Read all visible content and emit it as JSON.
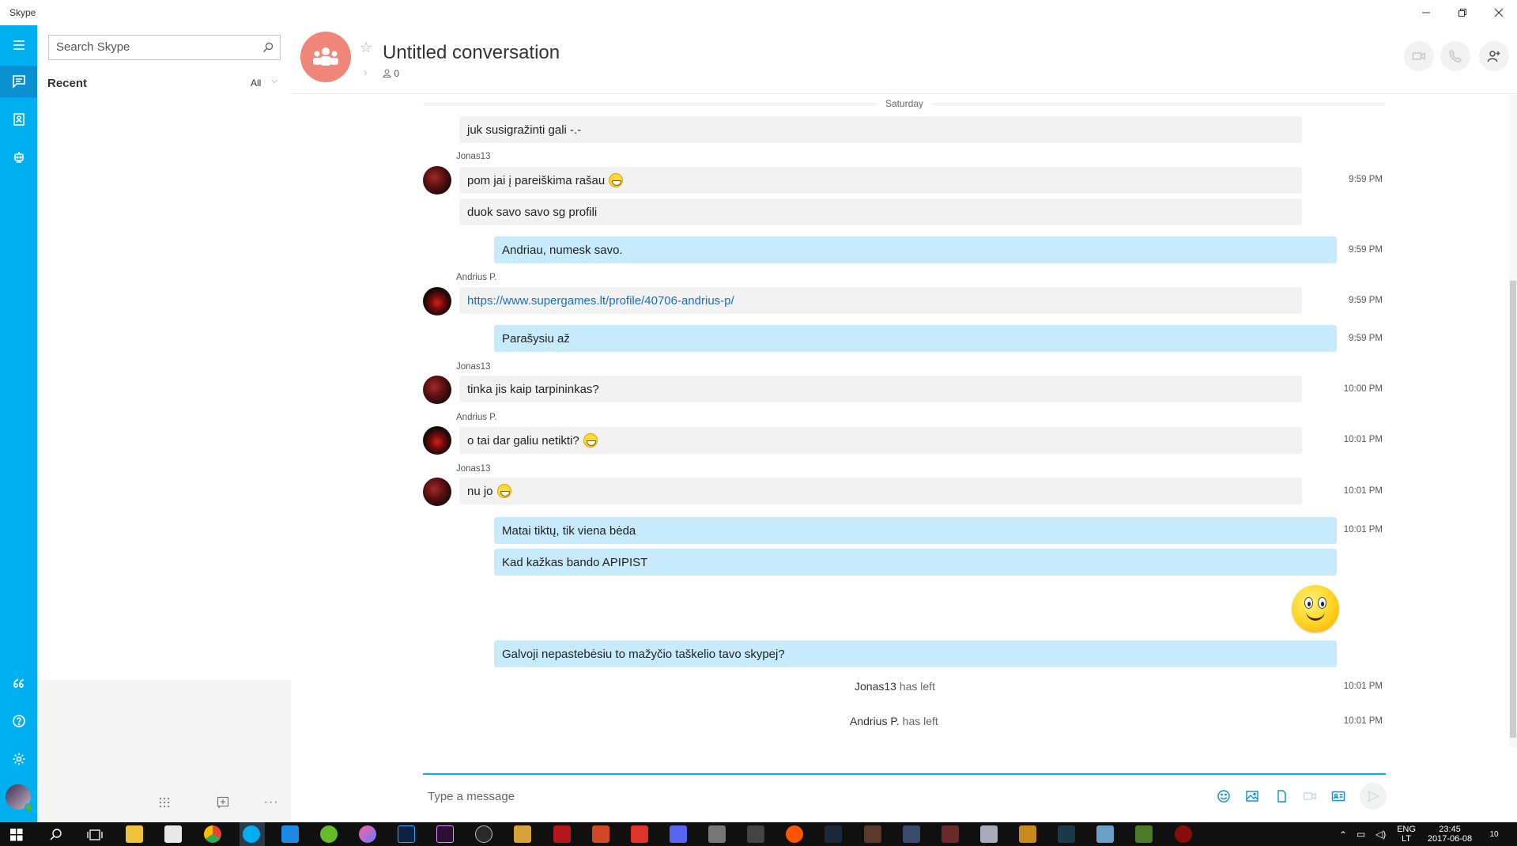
{
  "window": {
    "title": "Skype"
  },
  "sidebar": {
    "search_placeholder": "Search Skype",
    "recent_label": "Recent",
    "filter_label": "All"
  },
  "conversation": {
    "title": "Untitled conversation",
    "participants": "0",
    "avatar_color": "#f0867a"
  },
  "messages": {
    "day": "Saturday",
    "m1": {
      "text": "juk susigražinti gali -.-"
    },
    "m2": {
      "sender": "Jonas13",
      "text": "pom jai į pareiškima rašau",
      "time": "9:59 PM"
    },
    "m3": {
      "text": "duok savo savo sg profili"
    },
    "m4": {
      "text": "Andriau, numesk savo.",
      "time": "9:59 PM"
    },
    "m5": {
      "sender": "Andrius P.",
      "text": "https://www.supergames.lt/profile/40706-andrius-p/",
      "time": "9:59 PM"
    },
    "m6": {
      "text": "Parašysiu až",
      "time": "9:59 PM"
    },
    "m7": {
      "sender": "Jonas13",
      "text": "tinka jis kaip tarpininkas?",
      "time": "10:00 PM"
    },
    "m8": {
      "sender": "Andrius P.",
      "text": "o tai dar galiu netikti?",
      "time": "10:01 PM"
    },
    "m9": {
      "sender": "Jonas13",
      "text": "nu jo",
      "time": "10:01 PM"
    },
    "m10": {
      "text": "Matai tiktų, tik viena bėda",
      "time": "10:01 PM"
    },
    "m11": {
      "text": "Kad kažkas bando APIPIST"
    },
    "m12": {
      "text": "Galvoji nepastebėsiu to mažyčio taškelio tavo skypej?"
    },
    "s1": {
      "name": "Jonas13",
      "action": "has left",
      "time": "10:01 PM"
    },
    "s2": {
      "name": "Andrius P.",
      "action": "has left",
      "time": "10:01 PM"
    }
  },
  "composer": {
    "placeholder": "Type a message"
  },
  "taskbar": {
    "lang": "ENG",
    "locale": "LT",
    "clock": "23:45",
    "date": "2017-06-08",
    "notifications": "10"
  },
  "colors": {
    "accent": "#00aff0",
    "outgoing": "#c7eafc",
    "incoming": "#f2f2f2"
  }
}
